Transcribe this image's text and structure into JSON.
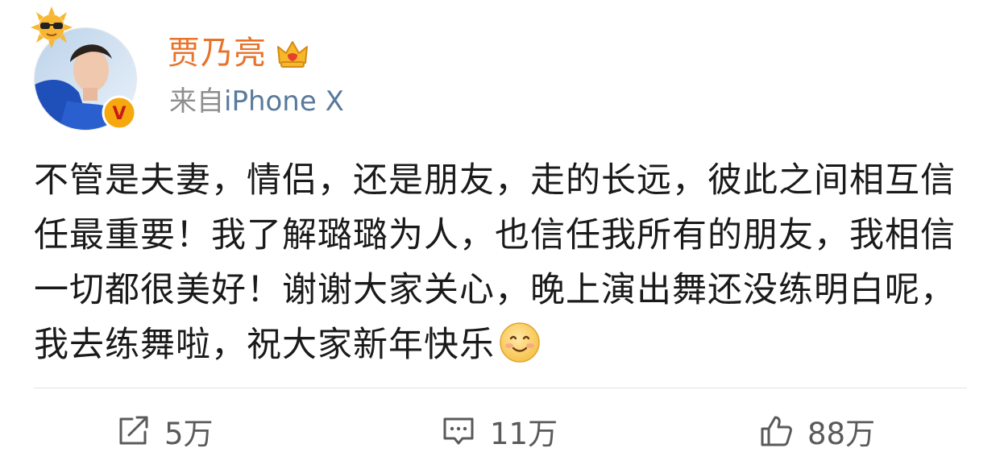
{
  "post": {
    "username": "贾乃亮",
    "source_prefix": "来自",
    "source_device": "iPhone X",
    "text": "不管是夫妻，情侣，还是朋友，走的长远，彼此之间相互信任最重要！我了解璐璐为人，也信任我所有的朋友，我相信一切都很美好！谢谢大家关心，晚上演出舞还没练明白呢，我去练舞啦，祝大家新年快乐",
    "trailing_emoji": "smile-emoji"
  },
  "actions": {
    "repost_count": "5万",
    "comment_count": "11万",
    "like_count": "88万"
  },
  "colors": {
    "username": "#e8732a",
    "source_device": "#5a7a9c",
    "text": "#1a1a1a",
    "action_gray": "#5a5a5a",
    "divider": "#e3e3e3"
  }
}
